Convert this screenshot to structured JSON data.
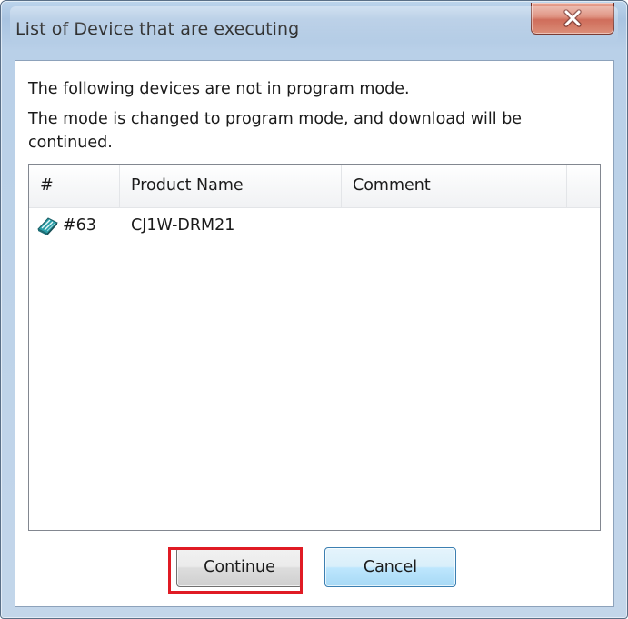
{
  "window": {
    "title": "List of Device that are executing",
    "close_icon": "close-x-icon"
  },
  "message": {
    "line1": "The following devices are not in program mode.",
    "line2": "The mode is changed to program mode, and download will be continued."
  },
  "table": {
    "columns": [
      "#",
      "Product Name",
      "Comment"
    ],
    "rows": [
      {
        "icon": "device-module-icon",
        "number": "#63",
        "product_name": "CJ1W-DRM21",
        "comment": ""
      }
    ]
  },
  "buttons": {
    "continue_label": "Continue",
    "cancel_label": "Cancel"
  },
  "colors": {
    "highlight": "#e01b24",
    "close_button": "#c2452d",
    "default_button_border": "#3c7fb1"
  }
}
